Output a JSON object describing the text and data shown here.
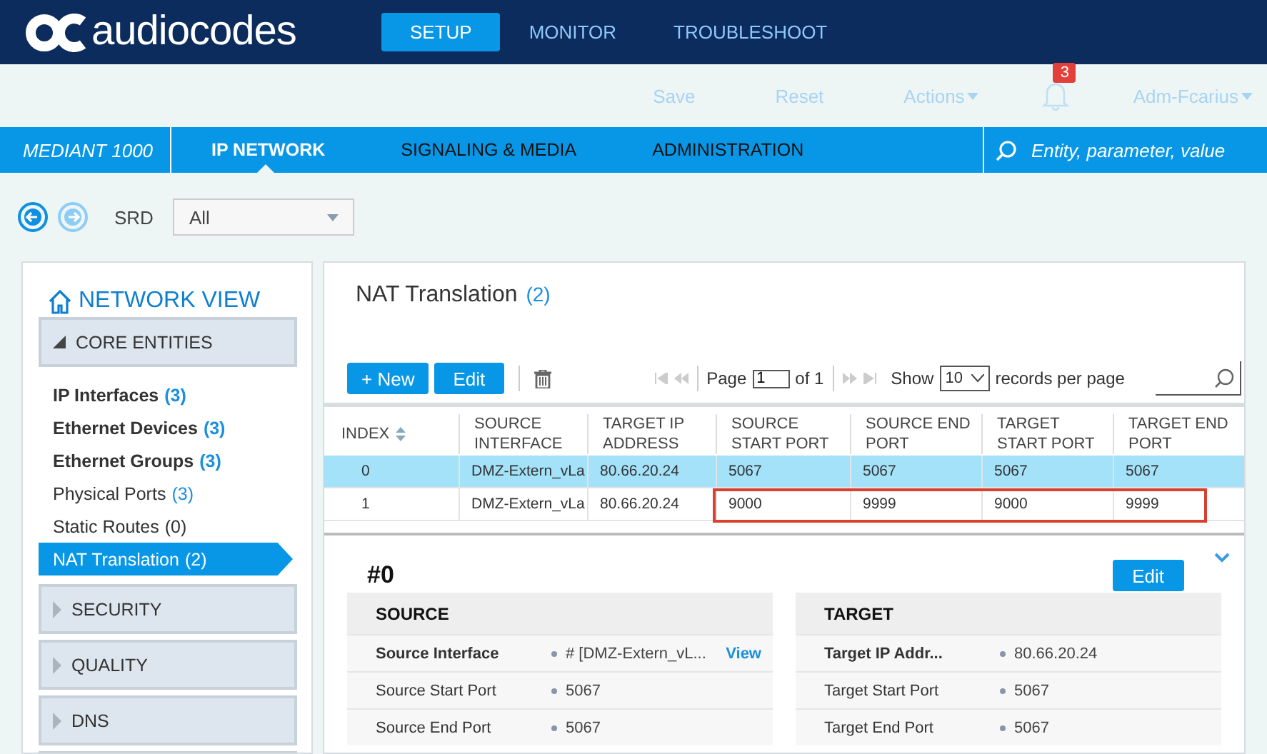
{
  "header": {
    "logo": "audiocodes",
    "tabs": [
      {
        "label": "SETUP",
        "selected": true
      },
      {
        "label": "MONITOR",
        "selected": false
      },
      {
        "label": "TROUBLESHOOT",
        "selected": false
      }
    ]
  },
  "toolbar": {
    "save": "Save",
    "reset": "Reset",
    "actions": "Actions",
    "notifications": "3",
    "user": "Adm-Fcarius"
  },
  "navbar": {
    "device": "MEDIANT 1000",
    "tabs": [
      {
        "label": "IP NETWORK",
        "selected": true
      },
      {
        "label": "SIGNALING & MEDIA",
        "selected": false
      },
      {
        "label": "ADMINISTRATION",
        "selected": false
      }
    ],
    "search": {
      "placeholder": "Entity, parameter, value"
    }
  },
  "srd": {
    "label": "SRD",
    "value": "All"
  },
  "sidebar": {
    "title": "NETWORK VIEW",
    "groups": [
      {
        "label": "CORE ENTITIES",
        "expanded": true,
        "items": [
          {
            "label": "IP Interfaces",
            "count": "(3)",
            "bold": true,
            "count_active": true,
            "selected": false
          },
          {
            "label": "Ethernet Devices",
            "count": "(3)",
            "bold": true,
            "count_active": true,
            "selected": false
          },
          {
            "label": "Ethernet Groups",
            "count": "(3)",
            "bold": true,
            "count_active": true,
            "selected": false
          },
          {
            "label": "Physical Ports",
            "count": "(3)",
            "bold": false,
            "count_active": true,
            "selected": false
          },
          {
            "label": "Static Routes",
            "count": "(0)",
            "bold": false,
            "count_active": false,
            "selected": false
          },
          {
            "label": "NAT Translation",
            "count": "(2)",
            "bold": false,
            "count_active": false,
            "selected": true
          }
        ]
      },
      {
        "label": "SECURITY",
        "expanded": false
      },
      {
        "label": "QUALITY",
        "expanded": false
      },
      {
        "label": "DNS",
        "expanded": false
      },
      {
        "expanded": false
      }
    ]
  },
  "main": {
    "title": "NAT Translation",
    "count": "(2)",
    "new_button": "+ New",
    "edit_button": "Edit",
    "pager": {
      "page_label": "Page",
      "page": "1",
      "of": "of 1",
      "show": "Show",
      "per_page": "10",
      "records": "records per page"
    },
    "table": {
      "columns": [
        "INDEX",
        "SOURCE INTERFACE",
        "TARGET IP ADDRESS",
        "SOURCE START PORT",
        "SOURCE END PORT",
        "TARGET START PORT",
        "TARGET END PORT"
      ],
      "rows": [
        {
          "cells": [
            "0",
            "DMZ-Extern_vLa",
            "80.66.20.24",
            "5067",
            "5067",
            "5067",
            "5067"
          ],
          "selected": true,
          "outlined": false
        },
        {
          "cells": [
            "1",
            "DMZ-Extern_vLa",
            "80.66.20.24",
            "9000",
            "9999",
            "9000",
            "9999"
          ],
          "selected": false,
          "outlined": true
        }
      ]
    },
    "detail": {
      "title": "#0",
      "edit_button": "Edit",
      "sections": [
        {
          "title": "SOURCE",
          "fields": [
            {
              "label": "Source Interface",
              "value": "# [DMZ-Extern_vL...",
              "link": "View",
              "bold": true
            },
            {
              "label": "Source Start Port",
              "value": "5067",
              "bold": false
            },
            {
              "label": "Source End Port",
              "value": "5067",
              "bold": false
            }
          ]
        },
        {
          "title": "TARGET",
          "fields": [
            {
              "label": "Target IP Addr...",
              "value": "80.66.20.24",
              "bold": true
            },
            {
              "label": "Target Start Port",
              "value": "5067",
              "bold": false
            },
            {
              "label": "Target End Port",
              "value": "5067",
              "bold": false
            }
          ]
        }
      ]
    }
  }
}
